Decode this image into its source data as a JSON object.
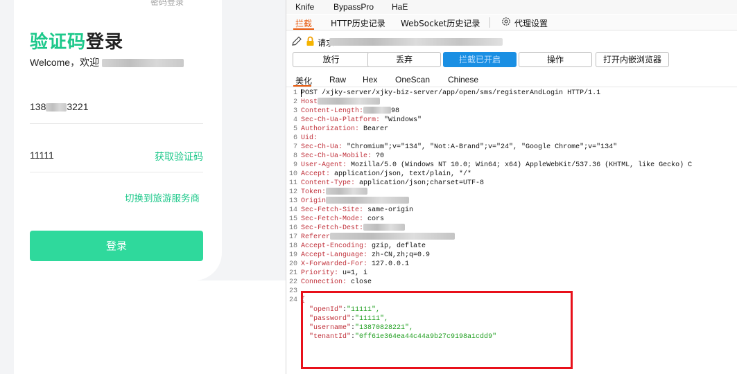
{
  "login": {
    "top_link": "密码登录",
    "title_green": "验证码",
    "title_black": "登录",
    "welcome": "Welcome，欢迎",
    "phone_prefix": "138",
    "phone_suffix": "3221",
    "code_value": "11111",
    "get_code_label": "获取验证码",
    "switch_label": "切换到旅游服务商",
    "login_button": "登录",
    "accent_color": "#1cc88a"
  },
  "burp": {
    "extension_tabs": [
      "Knife",
      "BypassPro",
      "HaE"
    ],
    "sub_tabs": [
      "拦截",
      "HTTP历史记录",
      "WebSocket历史记录",
      "代理设置"
    ],
    "request_label": "请求",
    "buttons": [
      "放行",
      "丢弃",
      "拦截已开启",
      "操作",
      "打开内嵌浏览器"
    ],
    "view_tabs": [
      "美化",
      "Raw",
      "Hex",
      "OneScan",
      "Chinese"
    ],
    "lines": [
      {
        "n": "1",
        "k": "",
        "v": "POST /xjky-server/xjky-biz-server/app/open/sms/registerAndLogin HTTP/1.1"
      },
      {
        "n": "2",
        "k": "Host",
        "v": ""
      },
      {
        "n": "3",
        "k": "Content-Length:",
        "v": "98"
      },
      {
        "n": "4",
        "k": "Sec-Ch-Ua-Platform:",
        "v": " \"Windows\""
      },
      {
        "n": "5",
        "k": "Authorization:",
        "v": " Bearer"
      },
      {
        "n": "6",
        "k": "Uid:",
        "v": ""
      },
      {
        "n": "7",
        "k": "Sec-Ch-Ua:",
        "v": " \"Chromium\";v=\"134\", \"Not:A-Brand\";v=\"24\", \"Google Chrome\";v=\"134\""
      },
      {
        "n": "8",
        "k": "Sec-Ch-Ua-Mobile:",
        "v": " ?0"
      },
      {
        "n": "9",
        "k": "User-Agent:",
        "v": " Mozilla/5.0 (Windows NT 10.0; Win64; x64) AppleWebKit/537.36 (KHTML, like Gecko) C"
      },
      {
        "n": "10",
        "k": "Accept:",
        "v": " application/json, text/plain, */*"
      },
      {
        "n": "11",
        "k": "Content-Type:",
        "v": " application/json;charset=UTF-8"
      },
      {
        "n": "12",
        "k": "Token:",
        "v": ""
      },
      {
        "n": "13",
        "k": "Origin",
        "v": ""
      },
      {
        "n": "14",
        "k": "Sec-Fetch-Site:",
        "v": " same-origin"
      },
      {
        "n": "15",
        "k": "Sec-Fetch-Mode:",
        "v": " cors"
      },
      {
        "n": "16",
        "k": "Sec-Fetch-Dest:",
        "v": ""
      },
      {
        "n": "17",
        "k": "Referer",
        "v": ""
      },
      {
        "n": "18",
        "k": "Accept-Encoding:",
        "v": " gzip, deflate"
      },
      {
        "n": "19",
        "k": "Accept-Language:",
        "v": " zh-CN,zh;q=0.9"
      },
      {
        "n": "20",
        "k": "X-Forwarded-For:",
        "v": " 127.0.0.1"
      },
      {
        "n": "21",
        "k": "Priority:",
        "v": " u=1, i"
      },
      {
        "n": "22",
        "k": "Connection:",
        "v": " close"
      },
      {
        "n": "23",
        "k": "",
        "v": ""
      },
      {
        "n": "24",
        "k": "",
        "v": "{"
      }
    ],
    "body": [
      {
        "k": "\"openId\"",
        "v": "\"11111\","
      },
      {
        "k": "\"password\"",
        "v": "\"11111\","
      },
      {
        "k": "\"username\"",
        "v": "\"13870828221\","
      },
      {
        "k": "\"tenantId\"",
        "v": "\"0ff61e364ea44c44a9b27c9198a1cdd9\""
      }
    ],
    "highlight_color": "#e8101a",
    "active_color": "#e8590c"
  }
}
